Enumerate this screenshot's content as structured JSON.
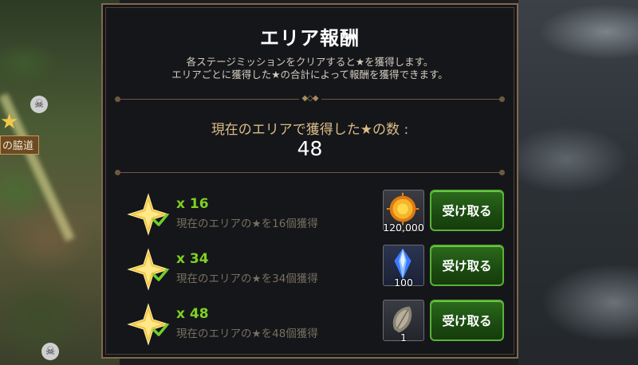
{
  "map": {
    "location_label": "の脇道"
  },
  "panel": {
    "title": "エリア報酬",
    "description_line1": "各ステージミッションをクリアすると★を獲得します。",
    "description_line2": "エリアごとに獲得した★の合計によって報酬を獲得できます。",
    "count_label": "現在のエリアで獲得した★の数 :",
    "count_value": "48"
  },
  "rewards": [
    {
      "threshold": "x 16",
      "condition": "現在のエリアの★を16個獲得",
      "item_icon": "gold-coin-icon",
      "quantity": "120,000",
      "claim_label": "受け取る",
      "completed": true
    },
    {
      "threshold": "x 34",
      "condition": "現在のエリアの★を34個獲得",
      "item_icon": "blue-crystal-icon",
      "quantity": "100",
      "claim_label": "受け取る",
      "completed": true
    },
    {
      "threshold": "x 48",
      "condition": "現在のエリアの★を48個獲得",
      "item_icon": "seed-icon",
      "quantity": "1",
      "claim_label": "受け取る",
      "completed": true
    }
  ],
  "colors": {
    "threshold_green": "#7ed023",
    "button_green": "#2c6a1c",
    "gold_text": "#d9bd86"
  }
}
